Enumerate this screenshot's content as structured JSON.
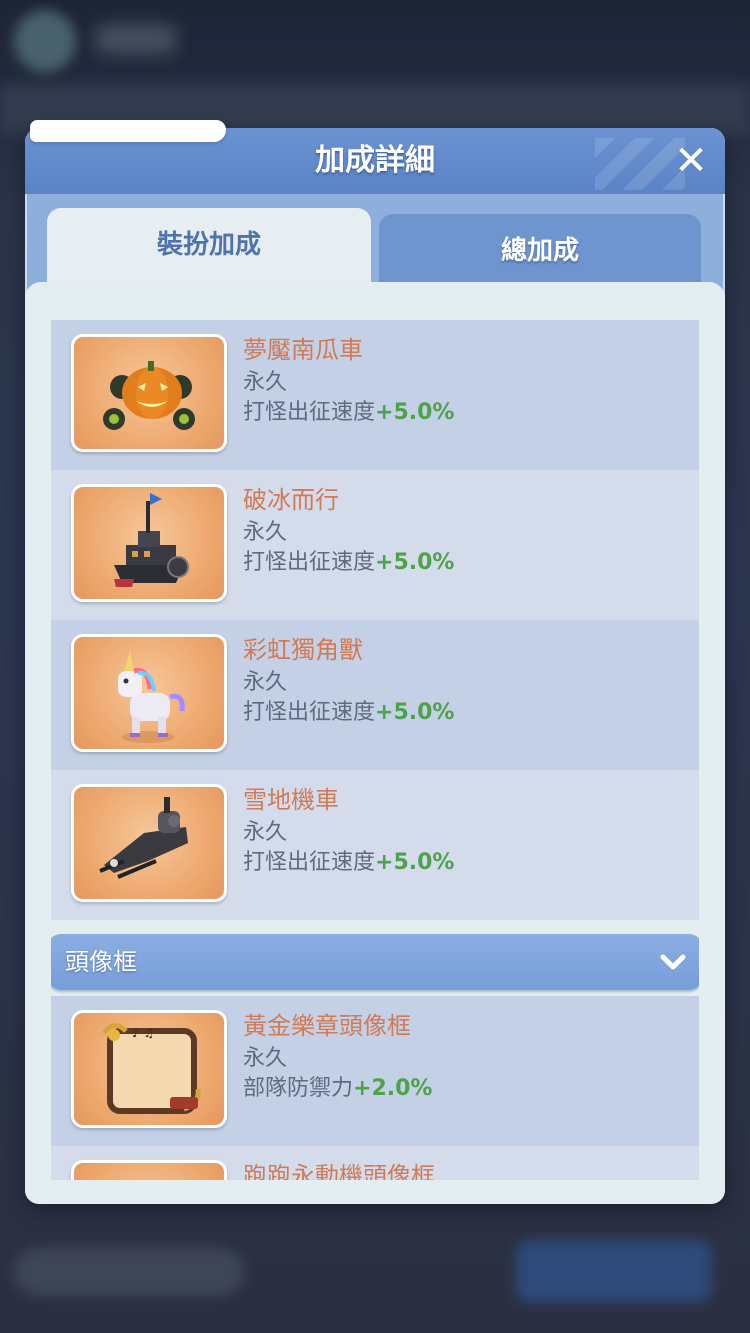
{
  "dialog": {
    "title": "加成詳細",
    "close_icon": "close-icon"
  },
  "tabs": [
    {
      "label": "裝扮加成",
      "active": true
    },
    {
      "label": "總加成",
      "active": false
    }
  ],
  "items": [
    {
      "name": "夢魘南瓜車",
      "duration": "永久",
      "effect": "打怪出征速度",
      "bonus": "+5.0%",
      "icon": "pumpkin-carriage-icon"
    },
    {
      "name": "破冰而行",
      "duration": "永久",
      "effect": "打怪出征速度",
      "bonus": "+5.0%",
      "icon": "icebreaker-ship-icon"
    },
    {
      "name": "彩虹獨角獸",
      "duration": "永久",
      "effect": "打怪出征速度",
      "bonus": "+5.0%",
      "icon": "rainbow-unicorn-icon"
    },
    {
      "name": "雪地機車",
      "duration": "永久",
      "effect": "打怪出征速度",
      "bonus": "+5.0%",
      "icon": "snowmobile-icon"
    }
  ],
  "section": {
    "title": "頭像框",
    "chevron_icon": "chevron-down-icon",
    "items": [
      {
        "name": "黃金樂章頭像框",
        "duration": "永久",
        "effect": "部隊防禦力",
        "bonus": "+2.0%",
        "icon": "golden-music-frame-icon"
      },
      {
        "name": "跑跑永動機頭像框",
        "icon": "perpetual-machine-frame-icon"
      }
    ]
  },
  "colors": {
    "name": "#d07b56",
    "bonus": "#4da34a",
    "text": "#5f6a80",
    "header": "#5a83c6"
  }
}
